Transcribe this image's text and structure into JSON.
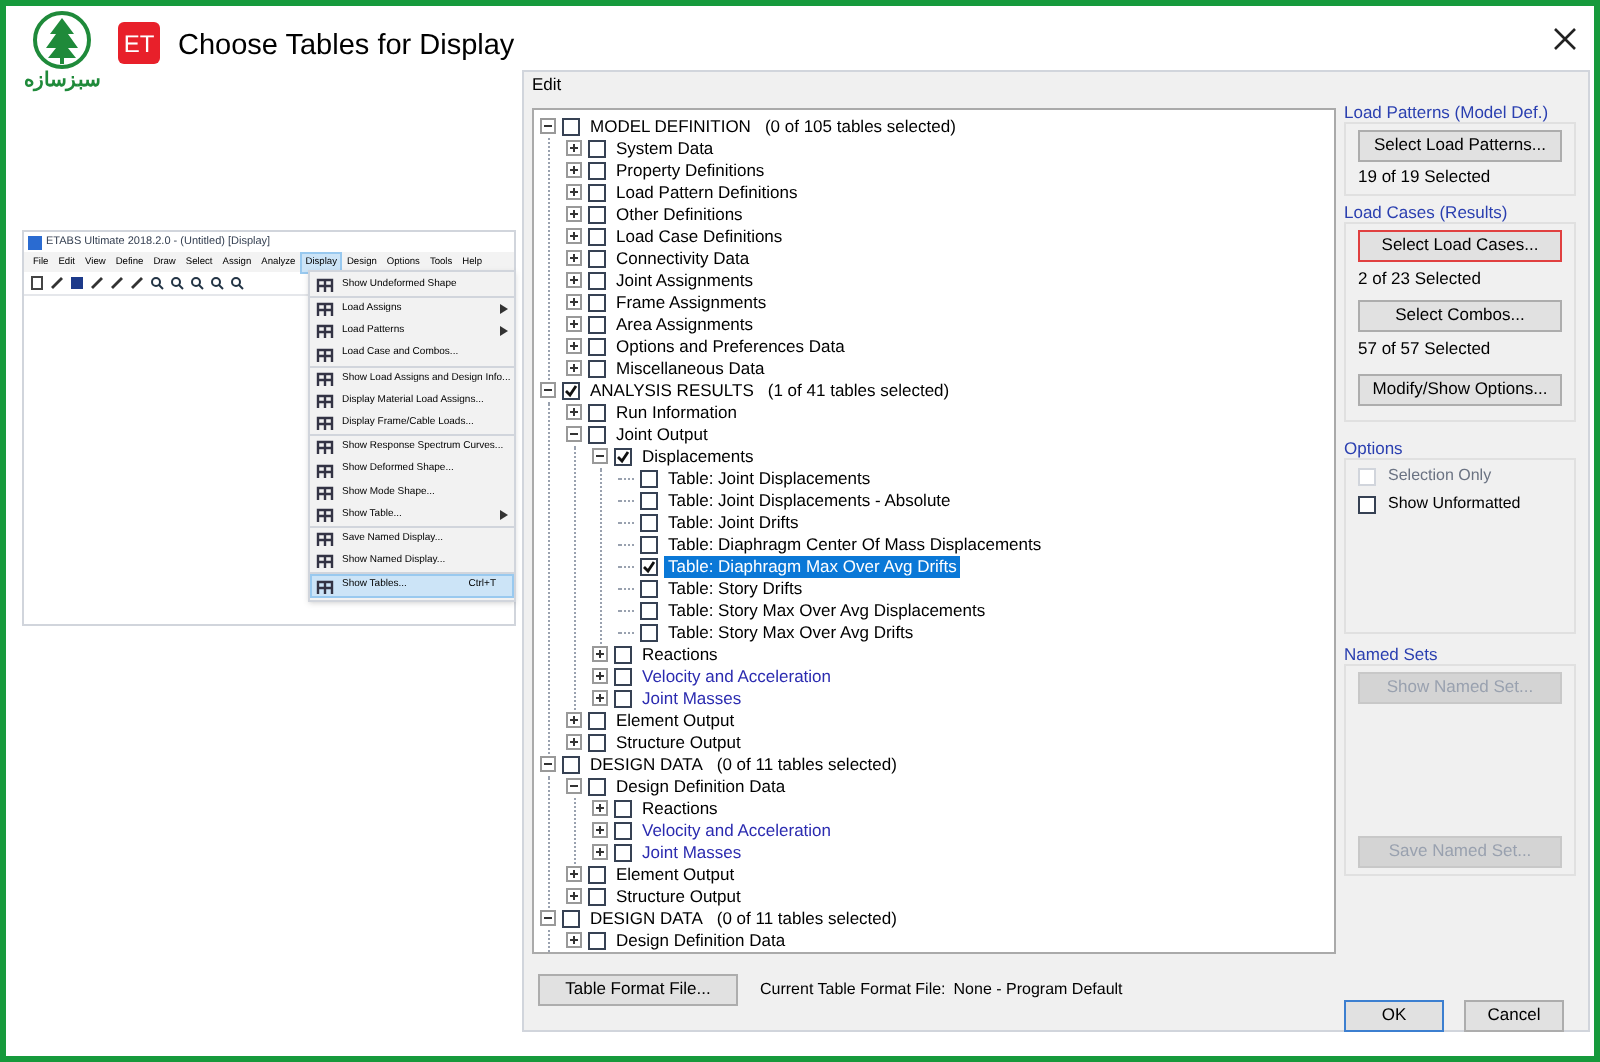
{
  "header": {
    "brand": "سبزسازه",
    "badge": "ET",
    "title": "Choose Tables for Display"
  },
  "inset": {
    "title": "ETABS Ultimate 2018.2.0 - (Untitled) [Display]",
    "menu": [
      {
        "label": "File",
        "selected": false
      },
      {
        "label": "Edit",
        "selected": false
      },
      {
        "label": "View",
        "selected": false
      },
      {
        "label": "Define",
        "selected": false
      },
      {
        "label": "Draw",
        "selected": false
      },
      {
        "label": "Select",
        "selected": false
      },
      {
        "label": "Assign",
        "selected": false
      },
      {
        "label": "Analyze",
        "selected": false
      },
      {
        "label": "Display",
        "selected": true
      },
      {
        "label": "Design",
        "selected": false
      },
      {
        "label": "Options",
        "selected": false
      },
      {
        "label": "Tools",
        "selected": false
      },
      {
        "label": "Help",
        "selected": false
      }
    ],
    "dropdown": [
      [
        {
          "label": "Show Undeformed Shape",
          "submenu": false,
          "selected": false
        }
      ],
      [
        {
          "label": "Load Assigns",
          "submenu": true,
          "selected": false
        },
        {
          "label": "Load Patterns",
          "submenu": true,
          "selected": false
        },
        {
          "label": "Load Case and Combos...",
          "submenu": false,
          "selected": false
        }
      ],
      [
        {
          "label": "Show Load Assigns and Design Info...",
          "submenu": false,
          "selected": false
        },
        {
          "label": "Display Material Load Assigns...",
          "submenu": false,
          "selected": false
        },
        {
          "label": "Display Frame/Cable Loads...",
          "submenu": false,
          "selected": false
        }
      ],
      [
        {
          "label": "Show Response Spectrum Curves...",
          "submenu": false,
          "selected": false
        },
        {
          "label": "Show Deformed Shape...",
          "submenu": false,
          "selected": false
        },
        {
          "label": "Show Mode Shape...",
          "submenu": false,
          "selected": false
        },
        {
          "label": "Show Table...",
          "submenu": true,
          "selected": false
        }
      ],
      [
        {
          "label": "Save Named Display...",
          "submenu": false,
          "selected": false
        },
        {
          "label": "Show Named Display...",
          "submenu": false,
          "selected": false
        }
      ],
      [
        {
          "label": "Show Tables...",
          "submenu": false,
          "selected": true,
          "shortcut": "Ctrl+T"
        }
      ]
    ]
  },
  "dialog": {
    "menu": [
      "Edit"
    ],
    "tree": [
      {
        "label": "MODEL DEFINITION",
        "count": "(0 of 105 tables selected)",
        "checked": false,
        "expanded": true,
        "children": [
          {
            "label": "System Data",
            "checked": false,
            "expanded": false
          },
          {
            "label": "Property Definitions",
            "checked": false,
            "expanded": false
          },
          {
            "label": "Load Pattern Definitions",
            "checked": false,
            "expanded": false
          },
          {
            "label": "Other Definitions",
            "checked": false,
            "expanded": false
          },
          {
            "label": "Load Case Definitions",
            "checked": false,
            "expanded": false
          },
          {
            "label": "Connectivity Data",
            "checked": false,
            "expanded": false
          },
          {
            "label": "Joint Assignments",
            "checked": false,
            "expanded": false
          },
          {
            "label": "Frame Assignments",
            "checked": false,
            "expanded": false
          },
          {
            "label": "Area Assignments",
            "checked": false,
            "expanded": false
          },
          {
            "label": "Options and Preferences Data",
            "checked": false,
            "expanded": false
          },
          {
            "label": "Miscellaneous Data",
            "checked": false,
            "expanded": false
          }
        ]
      },
      {
        "label": "ANALYSIS RESULTS",
        "count": "(1 of 41 tables selected)",
        "checked": true,
        "expanded": true,
        "children": [
          {
            "label": "Run Information",
            "checked": false,
            "expanded": false
          },
          {
            "label": "Joint Output",
            "checked": false,
            "expanded": true,
            "children": [
              {
                "label": "Displacements",
                "checked": true,
                "expanded": true,
                "children": [
                  {
                    "label": "Table:  Joint Displacements",
                    "checked": false,
                    "selected": false
                  },
                  {
                    "label": "Table:  Joint Displacements - Absolute",
                    "checked": false,
                    "selected": false
                  },
                  {
                    "label": "Table:  Joint Drifts",
                    "checked": false,
                    "selected": false
                  },
                  {
                    "label": "Table:  Diaphragm Center Of Mass Displacements",
                    "checked": false,
                    "selected": false
                  },
                  {
                    "label": "Table:  Diaphragm Max Over Avg Drifts",
                    "checked": true,
                    "selected": true
                  },
                  {
                    "label": "Table:  Story Drifts",
                    "checked": false,
                    "selected": false
                  },
                  {
                    "label": "Table:  Story Max Over Avg Displacements",
                    "checked": false,
                    "selected": false
                  },
                  {
                    "label": "Table:  Story Max Over Avg Drifts",
                    "checked": false,
                    "selected": false
                  }
                ]
              },
              {
                "label": "Reactions",
                "checked": false,
                "expanded": false
              },
              {
                "label": "Velocity and Acceleration",
                "checked": false,
                "expanded": false,
                "color": "#2b2bb0"
              },
              {
                "label": "Joint Masses",
                "checked": false,
                "expanded": false,
                "color": "#2b2bb0"
              }
            ]
          },
          {
            "label": "Element Output",
            "checked": false,
            "expanded": false
          },
          {
            "label": "Structure Output",
            "checked": false,
            "expanded": false
          }
        ]
      },
      {
        "label": "DESIGN DATA",
        "count": "(0 of 11 tables selected)",
        "checked": false,
        "expanded": true,
        "children": [
          {
            "label": "Design Definition Data",
            "checked": false,
            "expanded": true,
            "children": [
              {
                "label": "Reactions",
                "checked": false,
                "expanded": false
              },
              {
                "label": "Velocity and Acceleration",
                "checked": false,
                "expanded": false,
                "color": "#2b2bb0"
              },
              {
                "label": "Joint Masses",
                "checked": false,
                "expanded": false,
                "color": "#2b2bb0"
              }
            ]
          },
          {
            "label": "Element Output",
            "checked": false,
            "expanded": false
          },
          {
            "label": "Structure Output",
            "checked": false,
            "expanded": false
          }
        ]
      },
      {
        "label": "DESIGN DATA",
        "count": "(0 of 11 tables selected)",
        "checked": false,
        "expanded": true,
        "children": [
          {
            "label": "Design Definition Data",
            "checked": false,
            "expanded": false
          }
        ]
      }
    ],
    "format_button": "Table Format File...",
    "format_label": "Current Table Format File:",
    "format_value": "None - Program Default",
    "load_patterns": {
      "title": "Load Patterns (Model Def.)",
      "button": "Select Load Patterns...",
      "count": "19 of 19 Selected"
    },
    "load_cases": {
      "title": "Load Cases (Results)",
      "selections": [
        {
          "button": "Select Load Cases...",
          "focused": true,
          "count": "2 of 23 Selected"
        },
        {
          "button": "Select Combos...",
          "focused": false,
          "count": "57 of 57 Selected"
        }
      ],
      "options_button": "Modify/Show Options..."
    },
    "options": {
      "title": "Options",
      "items": [
        {
          "label": "Selection Only",
          "checked": false,
          "disabled": true
        },
        {
          "label": "Show Unformatted",
          "checked": false,
          "disabled": false
        }
      ]
    },
    "named_sets": {
      "title": "Named Sets",
      "buttons": [
        {
          "label": "Show Named Set...",
          "disabled": true
        },
        {
          "label": "Save Named Set...",
          "disabled": true
        }
      ]
    },
    "ok": "OK",
    "cancel": "Cancel"
  }
}
